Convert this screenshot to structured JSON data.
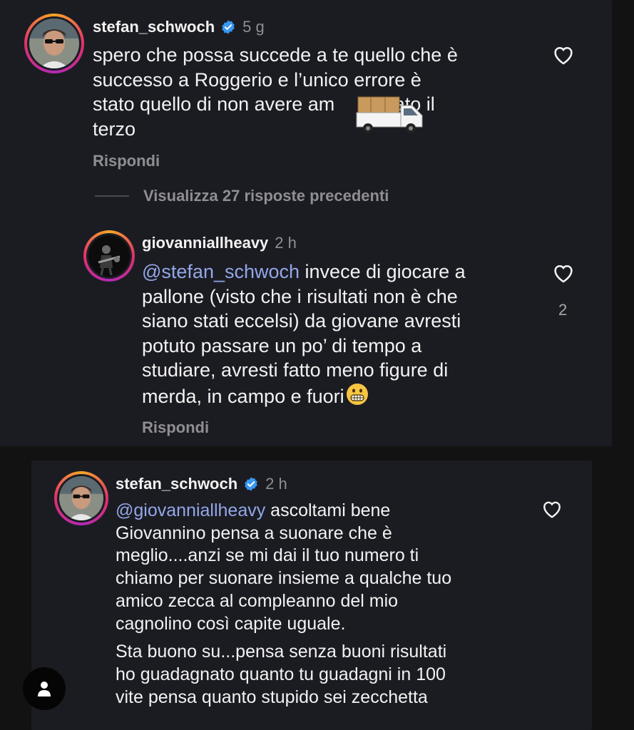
{
  "comment": {
    "username": "stefan_schwoch",
    "verified": true,
    "time": "5 g",
    "lines": [
      "spero che possa succede a te quello che è",
      "successo a Roggerio e l’unico errore è",
      "stato quello di non avere am",
      "zato il",
      "terzo"
    ],
    "reply_label": "Rispondi"
  },
  "view_previous": "Visualizza 27 risposte precedenti",
  "reply1": {
    "username": "giovanniallheavy",
    "time": "2 h",
    "mention": "@stefan_schwoch",
    "lines": [
      " invece di giocare a",
      "pallone (visto che i risultati non è che",
      "siano stati eccelsi) da giovane avresti",
      "potuto passare un po’ di tempo a",
      "studiare, avresti fatto meno figure di",
      "merda, in campo e fuori"
    ],
    "likes": "2",
    "reply_label": "Rispondi"
  },
  "reply2": {
    "username": "stefan_schwoch",
    "verified": true,
    "time": "2 h",
    "mention": "@giovanniallheavy",
    "lines": [
      " ascoltami bene",
      "Giovannino pensa a suonare che è",
      "meglio....anzi se mi dai il tuo numero ti",
      "chiamo per suonare insieme a qualche tuo",
      "amico zecca al compleanno del mio",
      "cagnolino così capite uguale."
    ],
    "lines2": [
      "Sta buono su...pensa senza buoni risultati",
      "ho guadagnato quanto tu guadagni in 100",
      "vite pensa quanto stupido sei zecchetta"
    ]
  },
  "colors": {
    "background": "#121212",
    "panel": "#1b1c22",
    "mention": "#93a7e8",
    "verified": "#3897f0",
    "muted": "#8e8e93"
  },
  "icons": [
    "verified-badge-icon",
    "heart-icon",
    "truck-sticker-icon",
    "grimace-emoji-icon",
    "profile-icon"
  ]
}
